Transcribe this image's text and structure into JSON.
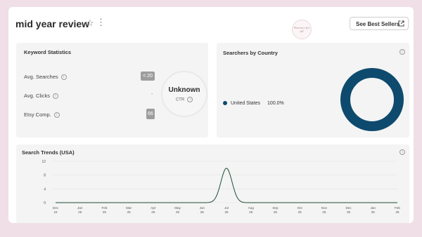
{
  "header": {
    "title": "mid year review",
    "star_icon": "star-outline-icon",
    "menu_icon": "vertical-dots-icon",
    "logo_text": "Planner for All",
    "button_label": "See Best Sellers",
    "button_icon": "external-link-icon"
  },
  "keyword_stats": {
    "title": "Keyword Statistics",
    "rows": [
      {
        "label": "Avg. Searches",
        "value": "< 20"
      },
      {
        "label": "Avg. Clicks",
        "value": "-"
      },
      {
        "label": "Etsy Comp.",
        "value": "66"
      }
    ],
    "ctr": {
      "value": "Unknown",
      "label": "CTR"
    }
  },
  "country": {
    "title": "Searchers by Country",
    "legend": [
      {
        "name": "United States",
        "pct": "100.0%",
        "color": "#0e4a6e"
      }
    ],
    "share": 1.0
  },
  "trends": {
    "title": "Search Trends (USA)"
  },
  "chart_data": {
    "type": "line",
    "title": "Search Trends (USA)",
    "xlabel": "",
    "ylabel": "",
    "x": [
      "Dec 24",
      "Jan 25",
      "Feb 25",
      "Mar 25",
      "Apr 25",
      "May 25",
      "Jun 25",
      "Jul 25",
      "Aug 25",
      "Sep 25",
      "Oct 25",
      "Nov 25",
      "Dec 25",
      "Jan 26",
      "Feb 26"
    ],
    "x_ticks": [
      [
        "Dec",
        "24"
      ],
      [
        "Jan",
        "25"
      ],
      [
        "Feb",
        "25"
      ],
      [
        "Mar",
        "25"
      ],
      [
        "Apr",
        "25"
      ],
      [
        "May",
        "25"
      ],
      [
        "Jun",
        "25"
      ],
      [
        "Jul",
        "25"
      ],
      [
        "Aug",
        "25"
      ],
      [
        "Sep",
        "25"
      ],
      [
        "Oct",
        "25"
      ],
      [
        "Nov",
        "25"
      ],
      [
        "Dec",
        "25"
      ],
      [
        "Jan",
        "26"
      ],
      [
        "Feb",
        "26"
      ]
    ],
    "values": [
      0,
      0,
      0,
      0,
      0,
      0,
      0,
      10,
      0,
      0,
      0,
      0,
      0,
      0,
      0
    ],
    "y_ticks": [
      0,
      4,
      8,
      12
    ],
    "ylim": [
      0,
      12
    ],
    "grid": true,
    "color": "#1f4d38"
  }
}
